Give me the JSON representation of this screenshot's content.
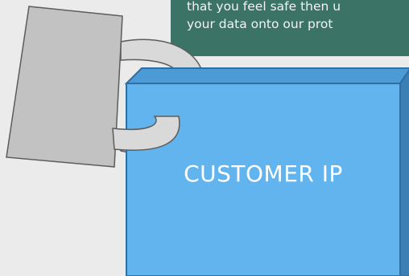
{
  "callout": {
    "line1": "that you feel safe then u",
    "line2": "your data onto our prot"
  },
  "box": {
    "label": "CUSTOMER IP",
    "face_color": "#62b4ee",
    "top_color": "#4c9ad6",
    "side_color": "#3c7fb4",
    "border_color": "#2f6fa3"
  },
  "padlock": {
    "body_color": "#c2c2c2",
    "shackle_color": "#d9d9d9",
    "outline_color": "#5c5c5c"
  }
}
